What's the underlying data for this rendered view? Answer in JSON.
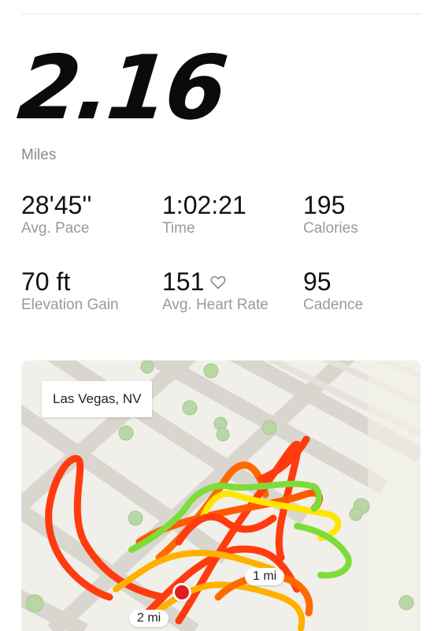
{
  "summary": {
    "distance": "2.16",
    "distance_unit": "Miles"
  },
  "stats": [
    {
      "value": "28'45''",
      "label": "Avg. Pace"
    },
    {
      "value": "1:02:21",
      "label": "Time"
    },
    {
      "value": "195",
      "label": "Calories"
    },
    {
      "value": "70 ft",
      "label": "Elevation Gain"
    },
    {
      "value": "151",
      "label": "Avg. Heart Rate"
    },
    {
      "value": "95",
      "label": "Cadence"
    }
  ],
  "icons": {
    "heart": "heart-outline-icon"
  },
  "map": {
    "location": "Las Vegas, NV",
    "markers": [
      "1 mi",
      "2 mi"
    ],
    "route_colors": [
      "#ff3b0f",
      "#ff8a00",
      "#ffe600",
      "#7edc3a"
    ]
  }
}
